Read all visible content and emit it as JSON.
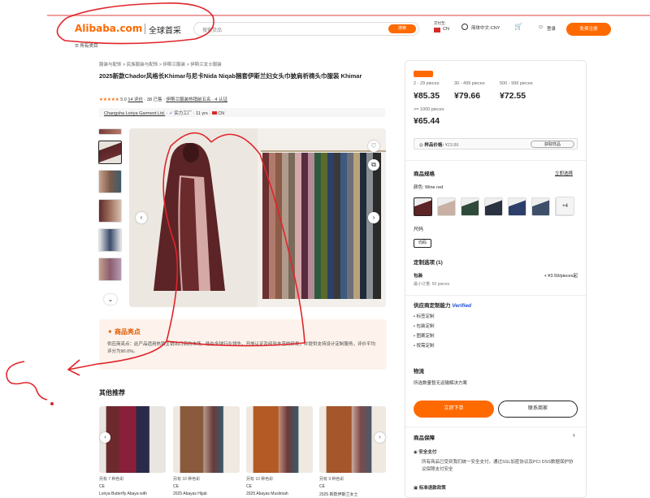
{
  "header": {
    "logo": "Alibaba.com",
    "logo_cn": "全球首采",
    "search_placeholder": "搜索货品",
    "search_button": "搜索",
    "deliver_label": "交付至:",
    "deliver_country": "CN",
    "language_currency": "简体中文-CNY",
    "signin": "登录",
    "signup": "免费注册",
    "all_categories": "所有类目"
  },
  "breadcrumb": "服装与配饰 > 民族服装与配饰 > 伊斯兰服装 > 伊斯兰女士服装",
  "product": {
    "title": "2025新款Chador风格长Khimar与尼卡Nida Niqab捆套伊斯兰妇女头巾披肩祈祷头巾服装 Khimar",
    "rating_stars": "★★★★★",
    "rating_value": "5.0",
    "reviews": "14 评价",
    "sold": "38 已售",
    "popularity": "伊斯兰服装热销前五名 · 4 认证",
    "supplier_name": "Changsha Loriya Garment Ltd.",
    "supplier_tag": "实力工厂",
    "supplier_years": "11 yrs",
    "supplier_country": "CN"
  },
  "highlights": {
    "title": "商品亮点",
    "text": "供应商亮点：此产品适用热销主销出口商的市场，能在全球行业领先，开放认证及经验丰富的研发，并提供支持设计定制服务，评价平均评分为90.0%。"
  },
  "recommendations": {
    "title": "其他推荐",
    "items": [
      {
        "swatches": "另有 7 种色彩",
        "ce": "CE",
        "name": "Loriya Butterfly Abaya with"
      },
      {
        "swatches": "另有 10 种色彩",
        "ce": "CE",
        "name": "2025 Abayas Hijab"
      },
      {
        "swatches": "另有 10 种色彩",
        "ce": "CE",
        "name": "2025 Abayas Muslimah"
      },
      {
        "swatches": "另有 9 种色彩",
        "ce": "CE",
        "name": "2025 新款伊斯兰女士"
      }
    ]
  },
  "pricing": {
    "tiers": [
      {
        "range": "2 - 29 pieces",
        "price": "¥85.35"
      },
      {
        "range": "30 - 499 pieces",
        "price": "¥79.66"
      },
      {
        "range": "500 - 999 pieces",
        "price": "¥72.55"
      },
      {
        "range": ">= 1000 pieces",
        "price": "¥65.44"
      }
    ],
    "sample_label": "样品价格:",
    "sample_price": "¥23.86",
    "sample_button": "获取样品"
  },
  "specs": {
    "title": "商品规格",
    "edit_link": "立即选择",
    "color_label": "颜色: Wine red",
    "more_colors": "+4",
    "size_label": "尺码",
    "size_value": "均码"
  },
  "custom": {
    "title": "定制选项 (1)",
    "pkg_label": "包装",
    "pkg_price": "+ ¥3.59/pieces起",
    "pkg_min": "最小订量: 50 pieces"
  },
  "capabilities": {
    "title": "供应商定制能力",
    "verified": "Verified",
    "items": [
      "标签定制",
      "包装定制",
      "图案定制",
      "按需定制"
    ]
  },
  "logistics": {
    "title": "物流",
    "text": "所选数量暂无运输解决方案"
  },
  "actions": {
    "order": "立即下单",
    "contact": "联系商家"
  },
  "protection": {
    "title": "商品保障",
    "secure_title": "安全支付",
    "secure_text": "所有商品已受到我们统一安全支付，通过SSL加密协议及PCI DSS数据保护协议保障支付安全",
    "standard_title": "标准退款政策"
  },
  "colors": {
    "accent": "#ff6a00",
    "annotation": "#e0242a"
  }
}
